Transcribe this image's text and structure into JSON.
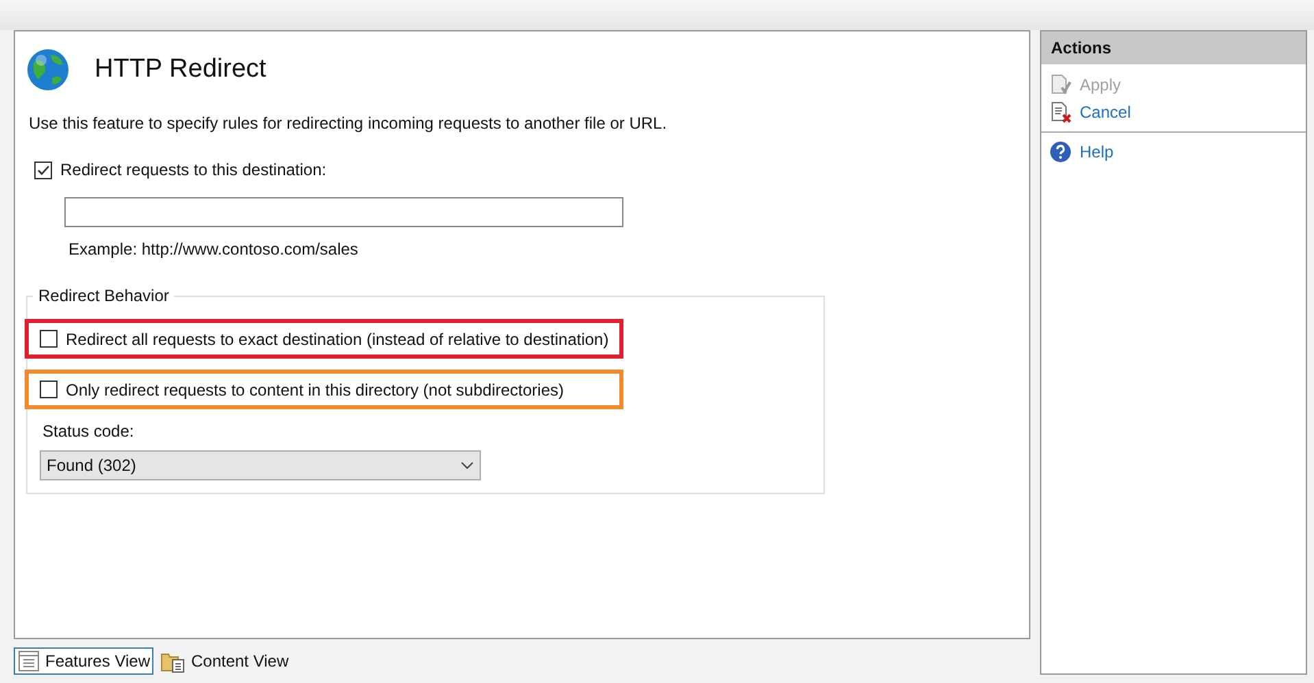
{
  "page": {
    "title": "HTTP Redirect",
    "description": "Use this feature to specify rules for redirecting incoming requests to another file or URL."
  },
  "redirect": {
    "label": "Redirect requests to this destination:",
    "checked": true,
    "example": "Example: http://www.contoso.com/sales"
  },
  "behavior": {
    "title": "Redirect Behavior",
    "options": [
      {
        "label": "Redirect all requests to exact destination (instead of relative to destination)",
        "checked": false,
        "color": "#e0202e"
      },
      {
        "label": "Only redirect requests to content in this directory (not subdirectories)",
        "checked": false,
        "color": "#f08a2c"
      }
    ],
    "status_label": "Status code:",
    "status_value": "Found (302)"
  },
  "actions": {
    "title": "Actions",
    "items": [
      {
        "kind": "apply",
        "label": "Apply",
        "disabled": true
      },
      {
        "kind": "cancel",
        "label": "Cancel",
        "disabled": false
      },
      {
        "kind": "help",
        "label": "Help",
        "disabled": false
      }
    ]
  },
  "view_tabs": [
    {
      "kind": "features",
      "label": "Features View",
      "selected": true
    },
    {
      "kind": "content",
      "label": "Content View",
      "selected": false
    }
  ]
}
